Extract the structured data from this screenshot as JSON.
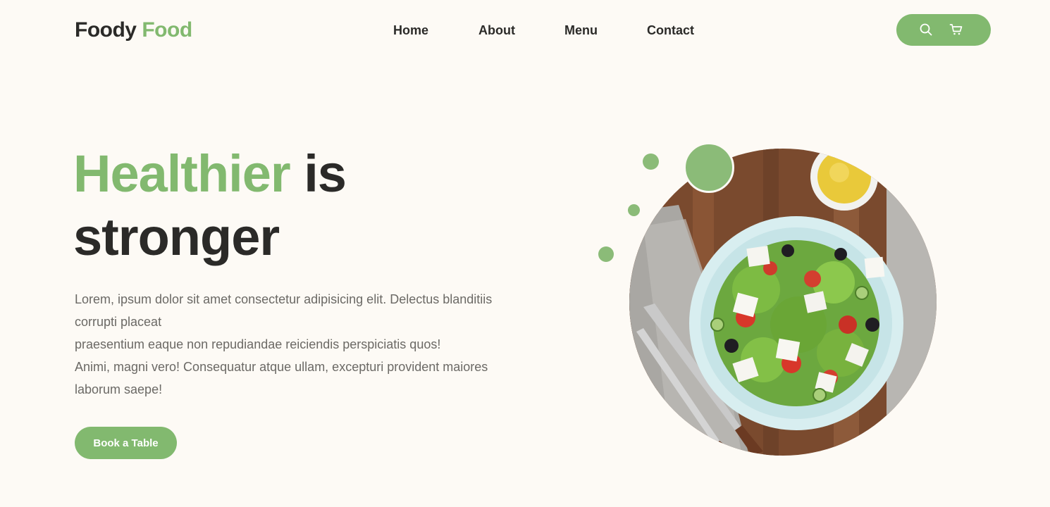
{
  "header": {
    "logo": {
      "primary": "Foody",
      "accent": "Food"
    },
    "nav": {
      "home": "Home",
      "about": "About",
      "menu": "Menu",
      "contact": "Contact"
    },
    "actions": {
      "search_icon": "search-icon",
      "cart_icon": "cart-icon"
    }
  },
  "hero": {
    "title": {
      "accent": "Healthier",
      "rest_line1": "is",
      "line2": "stronger"
    },
    "description": {
      "line1": "Lorem, ipsum dolor sit amet consectetur adipisicing elit. Delectus blanditiis",
      "line2": "corrupti placeat",
      "line3": "praesentium eaque non repudiandae reiciendis perspiciatis quos!",
      "line4": "Animi, magni vero! Consequatur atque ullam, excepturi provident maiores",
      "line5": "laborum saepe!"
    },
    "cta_label": "Book a Table"
  },
  "colors": {
    "accent": "#82b96f",
    "background": "#fdfaf5",
    "text": "#2b2a28",
    "muted_text": "#6b6965"
  }
}
